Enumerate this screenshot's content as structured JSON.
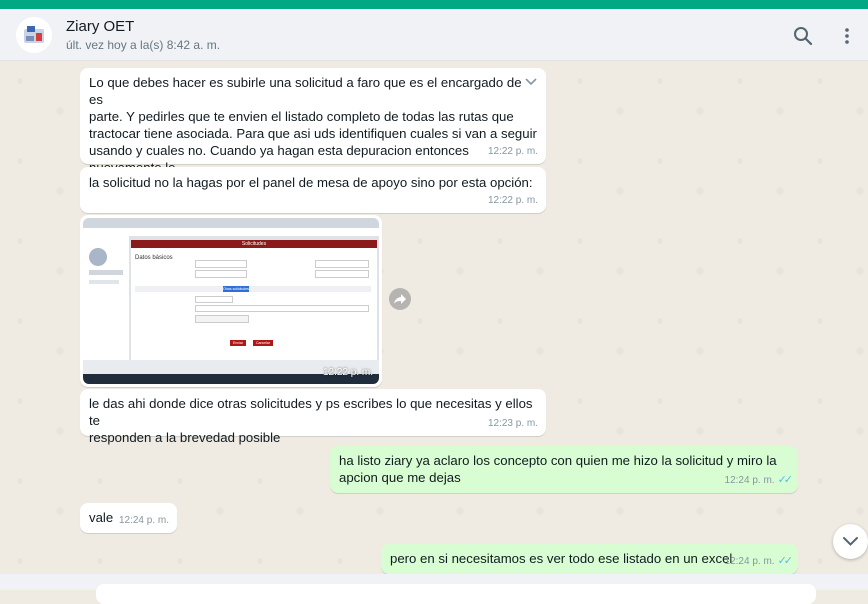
{
  "header": {
    "contact_name": "Ziary OET",
    "status": "últ. vez hoy a la(s) 8:42 a. m."
  },
  "icons": {
    "search": "search-icon",
    "menu": "kebab-menu-icon",
    "forward": "forward-icon",
    "scroll_down": "chevron-down-icon",
    "read_receipt": "double-check-icon"
  },
  "colors": {
    "accent": "#00a884",
    "incoming_bubble": "#ffffff",
    "outgoing_bubble": "#d9fdd3",
    "read_ticks": "#53bdeb"
  },
  "messages": [
    {
      "direction": "in",
      "text": "Lo que debes hacer es subirle una solicitud a faro que es el encargado de es\nparte. Y pedirles que te envien el listado completo de todas las rutas que\ntractocar tiene asociada. Para que asi uds identifiquen cuales si van a seguir\nusando y cuales no. Cuando ya hagan esta depuracion entonces nuevamente le\nsolicitan a faro que les elimine las rutas que uds digan y listo",
      "time": "12:22 p. m."
    },
    {
      "direction": "in",
      "text": "la solicitud no la hagas por el panel de mesa de apoyo sino por esta opción:",
      "time": "12:22 p. m."
    },
    {
      "direction": "in",
      "type": "image",
      "time": "12:22 p. m.",
      "image": {
        "banner_title": "Solicitudes",
        "section_title": "Datos básicos",
        "selected_tab": "Otras solicitudes",
        "primary_button": "Enviar",
        "secondary_button": "Cancelar"
      }
    },
    {
      "direction": "in",
      "text": "le das ahi donde dice otras solicitudes y ps escribes lo que necesitas y ellos te\nresponden a la brevedad posible",
      "time": "12:23 p. m."
    },
    {
      "direction": "out",
      "text": "ha listo ziary ya aclaro los concepto con quien me hizo la solicitud y miro la\napcion que me dejas",
      "time": "12:24 p. m."
    },
    {
      "direction": "in",
      "text": "vale",
      "time": "12:24 p. m."
    },
    {
      "direction": "out",
      "text": "pero en si necesitamos es ver todo ese listado en un excel",
      "time": "12:24 p. m."
    }
  ]
}
